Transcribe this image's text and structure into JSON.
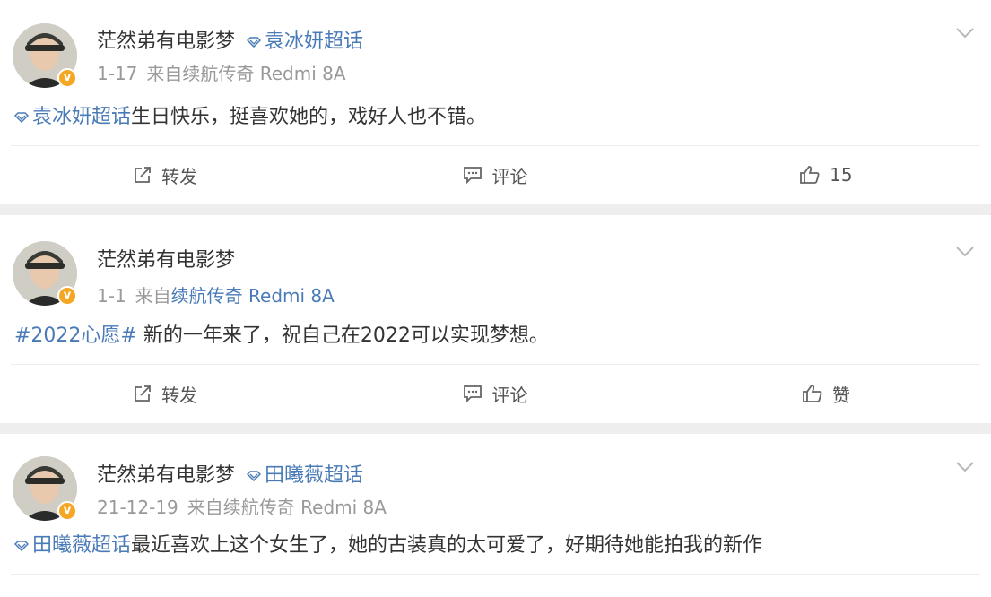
{
  "posts": [
    {
      "author": "茫然弟有电影梦",
      "topic_tag": "袁冰妍超话",
      "date": "1-17",
      "source_prefix": "来自",
      "source": "续航传奇 Redmi 8A",
      "source_link": false,
      "content_topic": "袁冰妍超话",
      "content_text": "生日快乐，挺喜欢她的，戏好人也不错。",
      "repost_label": "转发",
      "comment_label": "评论",
      "like_label": "15"
    },
    {
      "author": "茫然弟有电影梦",
      "topic_tag": "",
      "date": "1-1",
      "source_prefix": "来自",
      "source": "续航传奇 Redmi 8A",
      "source_link": true,
      "content_topic": "#2022心愿#",
      "content_text": " 新的一年来了，祝自己在2022可以实现梦想。",
      "repost_label": "转发",
      "comment_label": "评论",
      "like_label": "赞"
    },
    {
      "author": "茫然弟有电影梦",
      "topic_tag": "田曦薇超话",
      "date": "21-12-19",
      "source_prefix": "来自",
      "source": "续航传奇 Redmi 8A",
      "source_link": false,
      "content_topic": "田曦薇超话",
      "content_text": "最近喜欢上这个女生了，她的古装真的太可爱了，好期待她能拍我的新作"
    }
  ],
  "colors": {
    "link": "#4a7bb7",
    "badge": "#f5a623",
    "meta": "#999999"
  },
  "icons": {
    "topic": "diamond-icon",
    "repost": "repost-icon",
    "comment": "comment-icon",
    "like": "thumbs-up-icon",
    "menu": "chevron-down-icon",
    "verified": "verified-badge-icon"
  }
}
